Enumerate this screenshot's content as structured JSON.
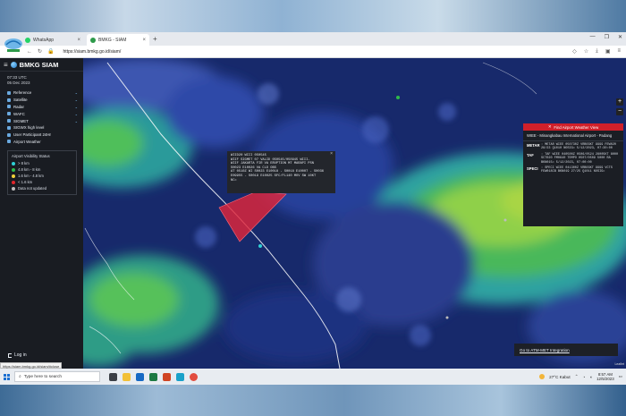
{
  "browser": {
    "tabs": [
      {
        "label": "WhatsApp",
        "active": false,
        "favicon_color": "#25d366"
      },
      {
        "label": "BMKG - SIAM",
        "active": true,
        "favicon_color": "#2e9a4a"
      }
    ],
    "new_tab_symbol": "+",
    "url": "https://siam.bmkg.go.id/siam/",
    "status_link": "https://siam.bmkg.go.id/siam/#close"
  },
  "sidebar": {
    "brand": "BMKG SIAM",
    "time": "07:33",
    "time_unit": "UTC",
    "date": "05 Dec 2023",
    "menu": [
      {
        "label": "Reference",
        "has_chevron": true
      },
      {
        "label": "Satellite",
        "has_chevron": true
      },
      {
        "label": "Radar",
        "has_chevron": true
      },
      {
        "label": "WAFC",
        "has_chevron": true
      },
      {
        "label": "SIGMET",
        "has_chevron": true
      },
      {
        "label": "SIGWX high level",
        "has_chevron": false
      },
      {
        "label": "User Participant 24Hr",
        "has_chevron": false
      },
      {
        "label": "Airport Weather",
        "has_chevron": false
      }
    ],
    "legend": {
      "title": "Airport Visibility Status",
      "items": [
        {
          "label": "> 8 km",
          "color": "#2fd0d6"
        },
        {
          "label": "4.8 km - 8 km",
          "color": "#2fb94a"
        },
        {
          "label": "1.6 km - 4.8 km",
          "color": "#f2d23a"
        },
        {
          "label": "< 1.6 km",
          "color": "#e0262b"
        },
        {
          "label": "Data not updated",
          "color": "#bdbdbd"
        }
      ]
    },
    "login": "Log in"
  },
  "sigmet_popup": {
    "lines": [
      "WIID20 WIII 050545",
      "WIIF SIGMET 07 VALID 050545/050945 WIII-",
      "WIIF JAKARTA FIR VA ERUPTION MT MARAPI PSN",
      "S0023 E10026 VA CLD OBS",
      "AT 0510Z WI S0023 E10018 - S0018 E10007 - S0036",
      "E09955 - S0019 E10025 SFC/FL140 MOV SW 10KT",
      "NC="
    ]
  },
  "airport_panel": {
    "header": "Find Airport Weather View",
    "title": "WIEE - Minangkabau International Airport - Padang",
    "rows": [
      {
        "key": "METAR",
        "value": ": METAR WIEE 050730Z VRB03KT 9999 FEW020 28/23 Q1010 NOSIG= 5/12/2023, 07:30:00"
      },
      {
        "key": "TAF",
        "value": ": TAF WIEE 040500Z 0506/0524 28005KT 8000 SCT020 FM0640 TEMPO 0507/0509 5000 RA BKN015= 5/12/2023, 07:00:00"
      },
      {
        "key": "SPECI",
        "value": ": SPECI WIEE 041300Z VRB03KT 9999 VCTS FEW018CB BKN019 27/25 Q1011 NOSIG="
      }
    ]
  },
  "map_controls": {
    "zoom_in": "+",
    "zoom_out": "−"
  },
  "atm_link": "Go to ATM-MET Integration",
  "scale_label": "Leaflet",
  "taskbar": {
    "search_placeholder": "Type here to search",
    "weather": "27°C  Kabut",
    "time": "8:57 AM",
    "date": "12/5/2023",
    "apps": [
      {
        "name": "task-view",
        "color": "#3b3f46"
      },
      {
        "name": "file-explorer",
        "color": "#f2c037"
      },
      {
        "name": "outlook",
        "color": "#1769c4"
      },
      {
        "name": "excel",
        "color": "#1d7a43"
      },
      {
        "name": "powerpoint",
        "color": "#d04423"
      },
      {
        "name": "edge",
        "color": "#1aa1c9"
      },
      {
        "name": "chrome",
        "color": "#e24c3f"
      }
    ]
  }
}
